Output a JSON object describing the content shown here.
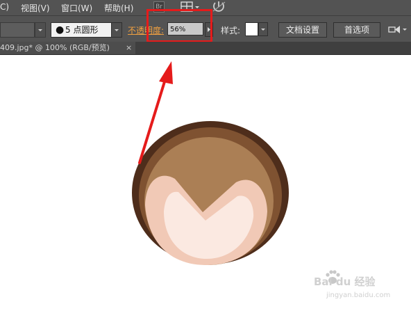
{
  "menubar": {
    "items": [
      {
        "label": "C)"
      },
      {
        "label": "视图(V)"
      },
      {
        "label": "窗口(W)"
      },
      {
        "label": "帮助(H)"
      }
    ],
    "br_icon_label": "Br"
  },
  "options": {
    "brush_profile": "5 点圆形",
    "opacity_label": "不透明度:",
    "opacity_value": "56%",
    "style_label": "样式:",
    "document_setup": "文档设置",
    "preferences": "首选项"
  },
  "tab": {
    "title": "409.jpg* @ 100% (RGB/预览)",
    "close": "×"
  },
  "watermark": {
    "text": "Bai du 经验",
    "sub": "jingyan.baidu.com"
  },
  "colors": {
    "panel_bg": "#535353",
    "highlight": "#e51b1b",
    "opacity_label": "#f0a040",
    "illustration": [
      "#4e2d1b",
      "#7f5231",
      "#ab7f55",
      "#f1c9b6",
      "#fbe9e1"
    ]
  },
  "icons": [
    "arrange-documents-icon",
    "gpu-performance-icon",
    "brush-dot-icon",
    "chevron-down-icon",
    "chevron-right-icon",
    "align-to-icon",
    "close-icon",
    "paw-icon"
  ]
}
